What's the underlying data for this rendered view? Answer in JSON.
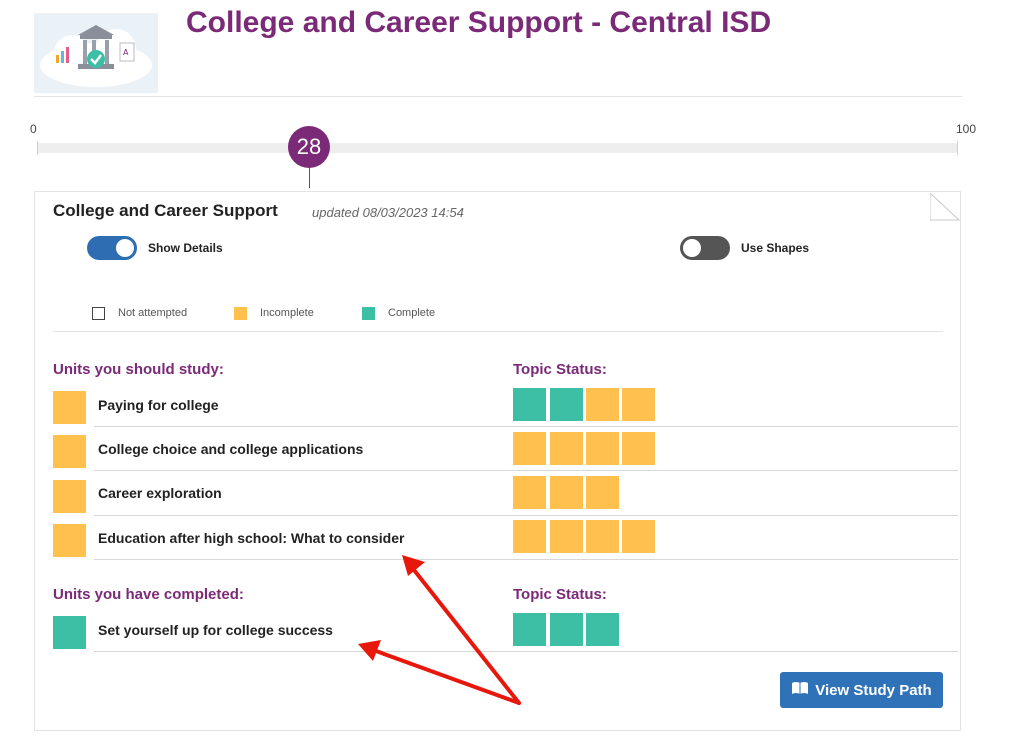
{
  "header": {
    "title": "College and Career Support - Central ISD"
  },
  "scale": {
    "min": "0",
    "max": "100",
    "score": "28",
    "score_value": 28
  },
  "card": {
    "title": "College and Career Support",
    "updated": "updated 08/03/2023 14:54",
    "toggles": {
      "show_details": "Show Details",
      "use_shapes": "Use Shapes"
    },
    "legend": {
      "not_attempted": "Not attempted",
      "incomplete": "Incomplete",
      "complete": "Complete"
    },
    "study": {
      "heading": "Units you should study:",
      "status_heading": "Topic Status:",
      "units": [
        {
          "label": "Paying for college"
        },
        {
          "label": "College choice and college applications"
        },
        {
          "label": "Career exploration"
        },
        {
          "label": "Education after high school: What to consider"
        }
      ]
    },
    "completed": {
      "heading": "Units you have completed:",
      "status_heading": "Topic Status:",
      "units": [
        {
          "label": "Set yourself up for college success"
        }
      ]
    },
    "button_label": "View Study Path"
  },
  "colors": {
    "accent": "#7b2a78",
    "incomplete": "#ffc04d",
    "complete": "#3dbfa5",
    "button": "#2f72b8",
    "annotation": "#e8170c"
  }
}
